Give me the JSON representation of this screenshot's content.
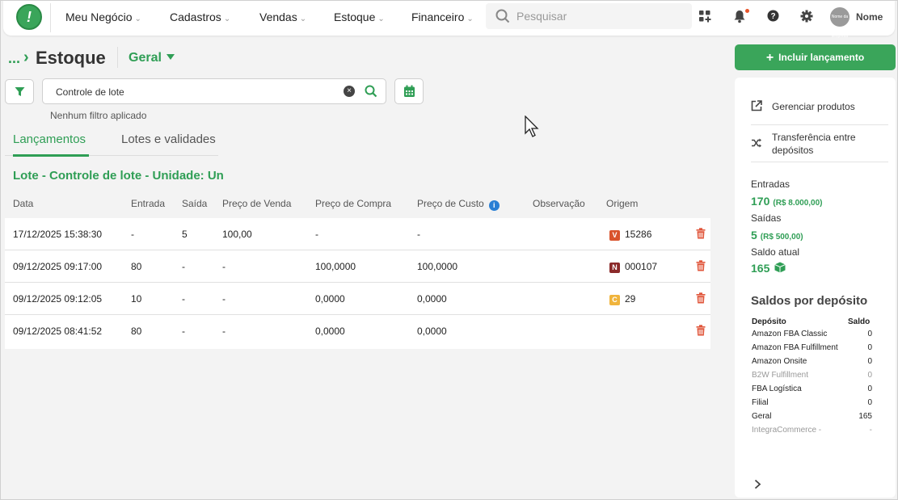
{
  "nav": {
    "items": [
      "Meu Negócio",
      "Cadastros",
      "Vendas",
      "Estoque",
      "Financeiro"
    ],
    "search_placeholder": "Pesquisar",
    "user_name": "Nome",
    "avatar_text": "Nome da Empresa",
    "logo_text": "!"
  },
  "breadcrumb": {
    "ellipsis": "...",
    "arrow": "›",
    "title": "Estoque",
    "deposit": "Geral"
  },
  "filter": {
    "search_value": "Controle de lote",
    "status": "Nenhum filtro aplicado"
  },
  "tabs": [
    "Lançamentos",
    "Lotes e validades"
  ],
  "lote_title": "Lote - Controle de lote - Unidade: Un",
  "table": {
    "headers": [
      "Data",
      "Entrada",
      "Saída",
      "Preço de Venda",
      "Preço de Compra",
      "Preço de Custo",
      "Observação",
      "Origem"
    ],
    "rows": [
      {
        "data": "17/12/2025 15:38:30",
        "entrada": "-",
        "saida": "5",
        "venda": "100,00",
        "compra": "-",
        "custo": "-",
        "obs": "",
        "origem_badge": "V",
        "origem_color": "#d9532c",
        "origem": "15286"
      },
      {
        "data": "09/12/2025 09:17:00",
        "entrada": "80",
        "saida": "-",
        "venda": "-",
        "compra": "100,0000",
        "custo": "100,0000",
        "obs": "",
        "origem_badge": "N",
        "origem_color": "#8b2a2a",
        "origem": "000107"
      },
      {
        "data": "09/12/2025 09:12:05",
        "entrada": "10",
        "saida": "-",
        "venda": "-",
        "compra": "0,0000",
        "custo": "0,0000",
        "obs": "",
        "origem_badge": "C",
        "origem_color": "#f0b43c",
        "origem": "29"
      },
      {
        "data": "09/12/2025 08:41:52",
        "entrada": "80",
        "saida": "-",
        "venda": "-",
        "compra": "0,0000",
        "custo": "0,0000",
        "obs": "",
        "origem_badge": "",
        "origem_color": "",
        "origem": ""
      }
    ]
  },
  "right": {
    "incluir_label": "Incluir lançamento",
    "actions": [
      "Gerenciar produtos",
      "Transferência entre depósitos"
    ],
    "entradas_label": "Entradas",
    "entradas_val": "170",
    "entradas_money": "(R$ 8.000,00)",
    "saidas_label": "Saídas",
    "saidas_val": "5",
    "saidas_money": "(R$ 500,00)",
    "saldo_label": "Saldo atual",
    "saldo_val": "165",
    "saldos_title": "Saldos por depósito",
    "dep_header": "Depósito",
    "saldo_header": "Saldo",
    "depositos": [
      {
        "name": "Amazon FBA Classic",
        "saldo": "0"
      },
      {
        "name": "Amazon FBA Fulfillment",
        "saldo": "0"
      },
      {
        "name": "Amazon Onsite",
        "saldo": "0"
      },
      {
        "name": "B2W Fulfillment",
        "saldo": "0"
      },
      {
        "name": "FBA Logística",
        "saldo": "0"
      },
      {
        "name": "Filial",
        "saldo": "0"
      },
      {
        "name": "Geral",
        "saldo": "165"
      },
      {
        "name": "IntegraCommerce -",
        "saldo": "-"
      }
    ]
  },
  "colors": {
    "brand_green": "#2f9e55",
    "button_green": "#3aa55a",
    "trash_red": "#e0553a",
    "info_blue": "#2a7fd4"
  }
}
